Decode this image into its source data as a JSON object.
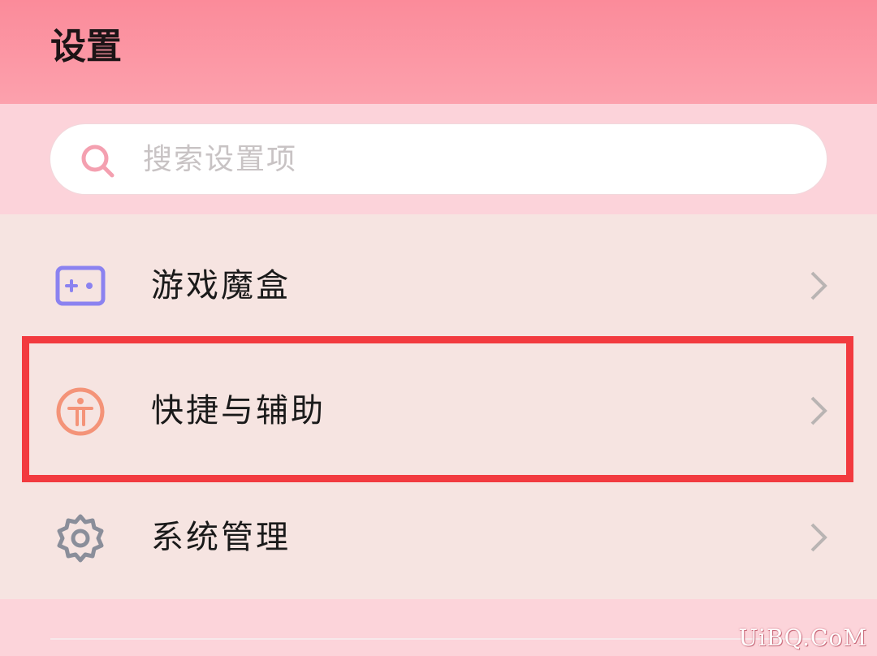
{
  "header": {
    "title": "设置"
  },
  "search": {
    "placeholder": "搜索设置项"
  },
  "list": {
    "items": [
      {
        "label": "游戏魔盒",
        "icon": "game-box-icon"
      },
      {
        "label": "快捷与辅助",
        "icon": "accessibility-icon",
        "highlighted": true
      },
      {
        "label": "系统管理",
        "icon": "gear-icon"
      }
    ]
  },
  "watermark": "UiBQ.CoM",
  "colors": {
    "header": "#fb8b9a",
    "highlight": "#f23a3f",
    "search_icon": "#f4a0b0",
    "game_icon": "#8b82f0",
    "accessibility_icon": "#f49378",
    "gear_icon": "#8a8e9a"
  }
}
